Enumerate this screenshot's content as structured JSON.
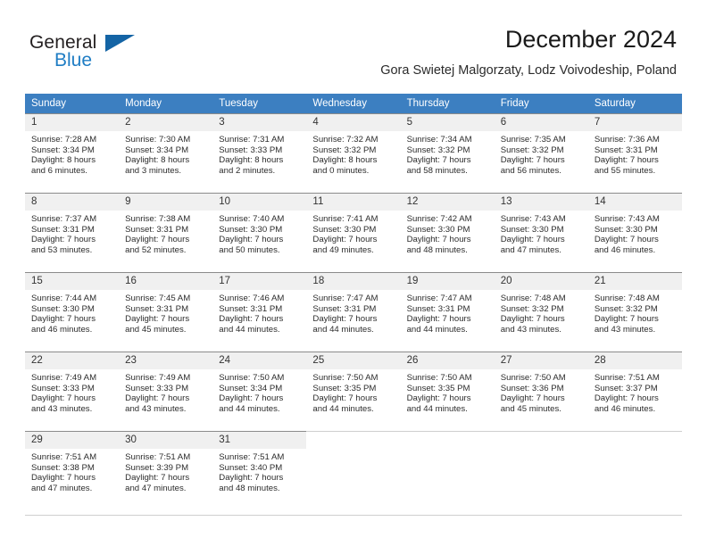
{
  "brand": {
    "name_top": "General",
    "name_bottom": "Blue",
    "logo_icon": "triangle-logo-icon",
    "color_top": "#231f20",
    "color_bottom": "#1f7dc4",
    "color_triangle": "#1464a5"
  },
  "header": {
    "title": "December 2024",
    "subtitle": "Gora Swietej Malgorzaty, Lodz Voivodeship, Poland"
  },
  "colors": {
    "header_row_bg": "#3c7fc1",
    "header_row_text": "#ffffff",
    "daynum_bg": "#f0f0f0",
    "grid_line": "#cfcfcf",
    "cell_top_rule": "#8b8b8b"
  },
  "weekdays": [
    "Sunday",
    "Monday",
    "Tuesday",
    "Wednesday",
    "Thursday",
    "Friday",
    "Saturday"
  ],
  "weeks": [
    [
      {
        "day": "1",
        "sunrise": "Sunrise: 7:28 AM",
        "sunset": "Sunset: 3:34 PM",
        "daylight_line1": "Daylight: 8 hours",
        "daylight_line2": "and 6 minutes."
      },
      {
        "day": "2",
        "sunrise": "Sunrise: 7:30 AM",
        "sunset": "Sunset: 3:34 PM",
        "daylight_line1": "Daylight: 8 hours",
        "daylight_line2": "and 3 minutes."
      },
      {
        "day": "3",
        "sunrise": "Sunrise: 7:31 AM",
        "sunset": "Sunset: 3:33 PM",
        "daylight_line1": "Daylight: 8 hours",
        "daylight_line2": "and 2 minutes."
      },
      {
        "day": "4",
        "sunrise": "Sunrise: 7:32 AM",
        "sunset": "Sunset: 3:32 PM",
        "daylight_line1": "Daylight: 8 hours",
        "daylight_line2": "and 0 minutes."
      },
      {
        "day": "5",
        "sunrise": "Sunrise: 7:34 AM",
        "sunset": "Sunset: 3:32 PM",
        "daylight_line1": "Daylight: 7 hours",
        "daylight_line2": "and 58 minutes."
      },
      {
        "day": "6",
        "sunrise": "Sunrise: 7:35 AM",
        "sunset": "Sunset: 3:32 PM",
        "daylight_line1": "Daylight: 7 hours",
        "daylight_line2": "and 56 minutes."
      },
      {
        "day": "7",
        "sunrise": "Sunrise: 7:36 AM",
        "sunset": "Sunset: 3:31 PM",
        "daylight_line1": "Daylight: 7 hours",
        "daylight_line2": "and 55 minutes."
      }
    ],
    [
      {
        "day": "8",
        "sunrise": "Sunrise: 7:37 AM",
        "sunset": "Sunset: 3:31 PM",
        "daylight_line1": "Daylight: 7 hours",
        "daylight_line2": "and 53 minutes."
      },
      {
        "day": "9",
        "sunrise": "Sunrise: 7:38 AM",
        "sunset": "Sunset: 3:31 PM",
        "daylight_line1": "Daylight: 7 hours",
        "daylight_line2": "and 52 minutes."
      },
      {
        "day": "10",
        "sunrise": "Sunrise: 7:40 AM",
        "sunset": "Sunset: 3:30 PM",
        "daylight_line1": "Daylight: 7 hours",
        "daylight_line2": "and 50 minutes."
      },
      {
        "day": "11",
        "sunrise": "Sunrise: 7:41 AM",
        "sunset": "Sunset: 3:30 PM",
        "daylight_line1": "Daylight: 7 hours",
        "daylight_line2": "and 49 minutes."
      },
      {
        "day": "12",
        "sunrise": "Sunrise: 7:42 AM",
        "sunset": "Sunset: 3:30 PM",
        "daylight_line1": "Daylight: 7 hours",
        "daylight_line2": "and 48 minutes."
      },
      {
        "day": "13",
        "sunrise": "Sunrise: 7:43 AM",
        "sunset": "Sunset: 3:30 PM",
        "daylight_line1": "Daylight: 7 hours",
        "daylight_line2": "and 47 minutes."
      },
      {
        "day": "14",
        "sunrise": "Sunrise: 7:43 AM",
        "sunset": "Sunset: 3:30 PM",
        "daylight_line1": "Daylight: 7 hours",
        "daylight_line2": "and 46 minutes."
      }
    ],
    [
      {
        "day": "15",
        "sunrise": "Sunrise: 7:44 AM",
        "sunset": "Sunset: 3:30 PM",
        "daylight_line1": "Daylight: 7 hours",
        "daylight_line2": "and 46 minutes."
      },
      {
        "day": "16",
        "sunrise": "Sunrise: 7:45 AM",
        "sunset": "Sunset: 3:31 PM",
        "daylight_line1": "Daylight: 7 hours",
        "daylight_line2": "and 45 minutes."
      },
      {
        "day": "17",
        "sunrise": "Sunrise: 7:46 AM",
        "sunset": "Sunset: 3:31 PM",
        "daylight_line1": "Daylight: 7 hours",
        "daylight_line2": "and 44 minutes."
      },
      {
        "day": "18",
        "sunrise": "Sunrise: 7:47 AM",
        "sunset": "Sunset: 3:31 PM",
        "daylight_line1": "Daylight: 7 hours",
        "daylight_line2": "and 44 minutes."
      },
      {
        "day": "19",
        "sunrise": "Sunrise: 7:47 AM",
        "sunset": "Sunset: 3:31 PM",
        "daylight_line1": "Daylight: 7 hours",
        "daylight_line2": "and 44 minutes."
      },
      {
        "day": "20",
        "sunrise": "Sunrise: 7:48 AM",
        "sunset": "Sunset: 3:32 PM",
        "daylight_line1": "Daylight: 7 hours",
        "daylight_line2": "and 43 minutes."
      },
      {
        "day": "21",
        "sunrise": "Sunrise: 7:48 AM",
        "sunset": "Sunset: 3:32 PM",
        "daylight_line1": "Daylight: 7 hours",
        "daylight_line2": "and 43 minutes."
      }
    ],
    [
      {
        "day": "22",
        "sunrise": "Sunrise: 7:49 AM",
        "sunset": "Sunset: 3:33 PM",
        "daylight_line1": "Daylight: 7 hours",
        "daylight_line2": "and 43 minutes."
      },
      {
        "day": "23",
        "sunrise": "Sunrise: 7:49 AM",
        "sunset": "Sunset: 3:33 PM",
        "daylight_line1": "Daylight: 7 hours",
        "daylight_line2": "and 43 minutes."
      },
      {
        "day": "24",
        "sunrise": "Sunrise: 7:50 AM",
        "sunset": "Sunset: 3:34 PM",
        "daylight_line1": "Daylight: 7 hours",
        "daylight_line2": "and 44 minutes."
      },
      {
        "day": "25",
        "sunrise": "Sunrise: 7:50 AM",
        "sunset": "Sunset: 3:35 PM",
        "daylight_line1": "Daylight: 7 hours",
        "daylight_line2": "and 44 minutes."
      },
      {
        "day": "26",
        "sunrise": "Sunrise: 7:50 AM",
        "sunset": "Sunset: 3:35 PM",
        "daylight_line1": "Daylight: 7 hours",
        "daylight_line2": "and 44 minutes."
      },
      {
        "day": "27",
        "sunrise": "Sunrise: 7:50 AM",
        "sunset": "Sunset: 3:36 PM",
        "daylight_line1": "Daylight: 7 hours",
        "daylight_line2": "and 45 minutes."
      },
      {
        "day": "28",
        "sunrise": "Sunrise: 7:51 AM",
        "sunset": "Sunset: 3:37 PM",
        "daylight_line1": "Daylight: 7 hours",
        "daylight_line2": "and 46 minutes."
      }
    ],
    [
      {
        "day": "29",
        "sunrise": "Sunrise: 7:51 AM",
        "sunset": "Sunset: 3:38 PM",
        "daylight_line1": "Daylight: 7 hours",
        "daylight_line2": "and 47 minutes."
      },
      {
        "day": "30",
        "sunrise": "Sunrise: 7:51 AM",
        "sunset": "Sunset: 3:39 PM",
        "daylight_line1": "Daylight: 7 hours",
        "daylight_line2": "and 47 minutes."
      },
      {
        "day": "31",
        "sunrise": "Sunrise: 7:51 AM",
        "sunset": "Sunset: 3:40 PM",
        "daylight_line1": "Daylight: 7 hours",
        "daylight_line2": "and 48 minutes."
      },
      {
        "day": "",
        "sunrise": "",
        "sunset": "",
        "daylight_line1": "",
        "daylight_line2": ""
      },
      {
        "day": "",
        "sunrise": "",
        "sunset": "",
        "daylight_line1": "",
        "daylight_line2": ""
      },
      {
        "day": "",
        "sunrise": "",
        "sunset": "",
        "daylight_line1": "",
        "daylight_line2": ""
      },
      {
        "day": "",
        "sunrise": "",
        "sunset": "",
        "daylight_line1": "",
        "daylight_line2": ""
      }
    ]
  ]
}
